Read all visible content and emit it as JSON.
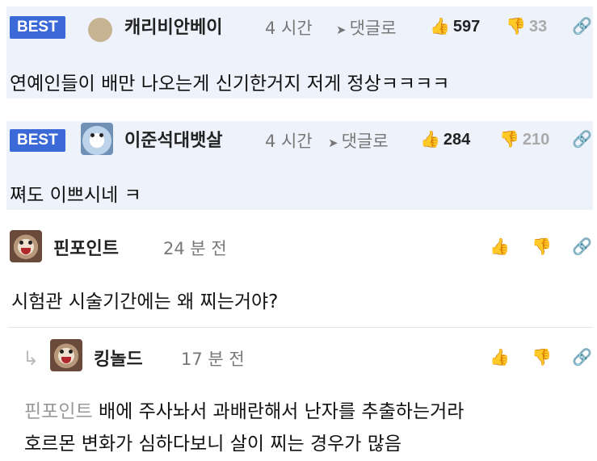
{
  "comments": [
    {
      "badge": "BEST",
      "author": "캐리비안베이",
      "time": "4 시간",
      "reply_label": "댓글로",
      "likes": "597",
      "dislikes": "33",
      "text": "연예인들이 배만 나오는게 신기한거지 저게 정상ㅋㅋㅋㅋ"
    },
    {
      "badge": "BEST",
      "author": "이준석대뱃살",
      "time": "4 시간",
      "reply_label": "댓글로",
      "likes": "284",
      "dislikes": "210",
      "text": "쪄도 이쁘시네 ㅋ"
    },
    {
      "author": "핀포인트",
      "time": "24 분 전",
      "text": "시험관 시술기간에는 왜 찌는거야?"
    }
  ],
  "reply": {
    "author": "킹놀드",
    "time": "17 분 전",
    "mention": "핀포인트",
    "text_line1": "배에 주사놔서 과배란해서 난자를 추출하는거라",
    "text_line2": "호르몬 변화가 심하다보니 살이 찌는 경우가 많음"
  },
  "icons": {
    "thumbs_up": "👍",
    "thumbs_down": "👎",
    "link": "🔗",
    "reply_arrow": "➤",
    "nested_reply": "↳"
  },
  "colors": {
    "best_badge": "#3b69d8",
    "best_background": "#eef2fb",
    "muted_text": "#777777"
  }
}
